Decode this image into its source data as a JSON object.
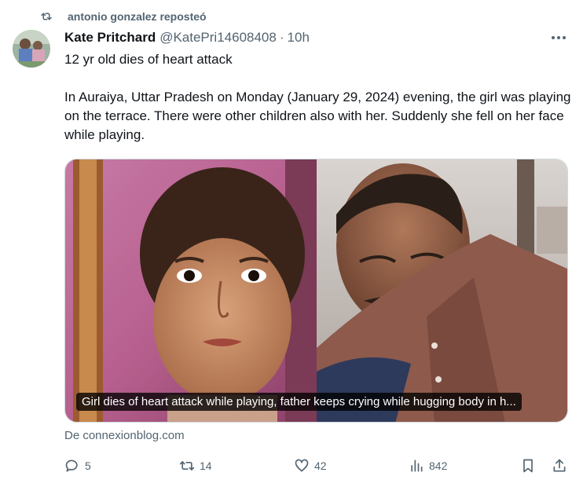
{
  "repost": {
    "icon": "repost-icon",
    "text": "antonio gonzalez reposteó"
  },
  "tweet": {
    "author_name": "Kate Pritchard",
    "handle": "@KatePri14608408",
    "separator": "·",
    "time": "10h",
    "text_line1": "12 yr old dies of heart attack",
    "text_paragraph": "In Auraiya, Uttar Pradesh on Monday (January 29, 2024) evening, the girl was playing on the terrace. There were other children also with her. Suddenly she fell on her face while playing.",
    "media_caption": "Girl dies of heart attack while playing, father keeps crying while hugging body in h...",
    "source": "De connexionblog.com"
  },
  "actions": {
    "reply": {
      "icon": "reply-icon",
      "count": "5"
    },
    "repost": {
      "icon": "repost-icon",
      "count": "14"
    },
    "like": {
      "icon": "heart-icon",
      "count": "42"
    },
    "views": {
      "icon": "views-icon",
      "count": "842"
    },
    "bookmark": {
      "icon": "bookmark-icon"
    },
    "share": {
      "icon": "share-icon"
    }
  },
  "colors": {
    "text_primary": "#0f1419",
    "text_secondary": "#536471",
    "border": "#cfd9de"
  }
}
